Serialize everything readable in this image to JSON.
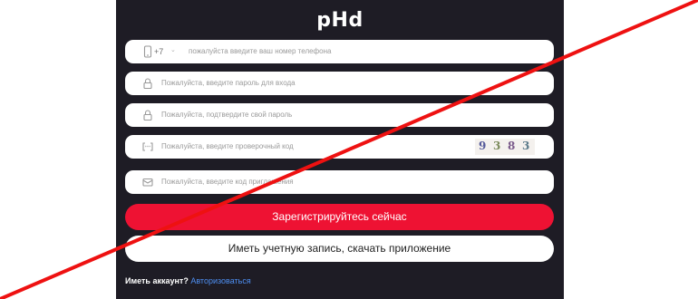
{
  "logo": {
    "text": "pHd"
  },
  "phone": {
    "country_code": "+7",
    "placeholder": "пожалуйста введите ваш номер телефона"
  },
  "password": {
    "placeholder": "Пожалуйста, введите пароль для входа"
  },
  "confirm_password": {
    "placeholder": "Пожалуйста, подтвердите свой пароль"
  },
  "verify_code": {
    "placeholder": "Пожалуйста, введите проверочный код",
    "captcha_digits": [
      "9",
      "3",
      "8",
      "3"
    ]
  },
  "invite_code": {
    "placeholder": "Пожалуйста, введите код приглашения"
  },
  "buttons": {
    "register": "Зарегистрируйтесь сейчас",
    "download_app": "Иметь учетную запись, скачать приложение"
  },
  "login_prompt": {
    "text": "Иметь аккаунт?",
    "link": "Авторизоваться"
  },
  "colors": {
    "panel_bg": "#1e1c25",
    "accent_red": "#ee1233",
    "link_blue": "#4e8ff2",
    "strike_red": "#ee1111"
  }
}
